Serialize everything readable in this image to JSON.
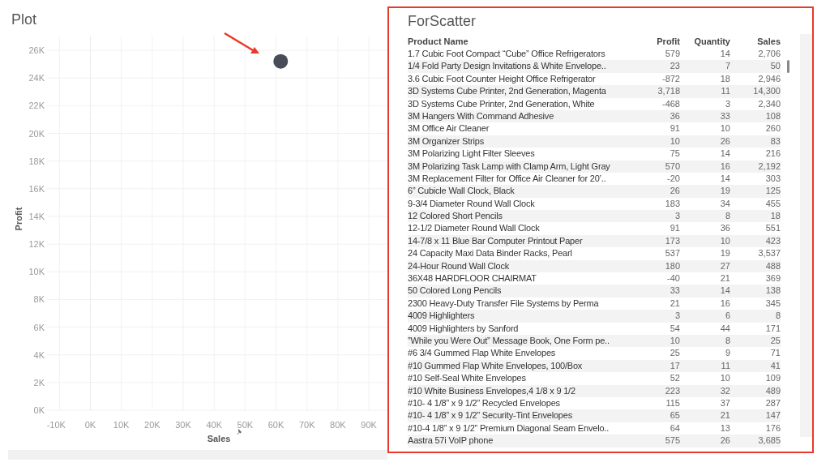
{
  "plot": {
    "title": "Plot",
    "chart_data": {
      "type": "scatter",
      "xlabel": "Sales",
      "ylabel": "Profit",
      "x": [
        61500
      ],
      "series": [
        {
          "color": "#474c57",
          "values": [
            25200
          ]
        }
      ],
      "grid": true,
      "ref_lines": [
        {
          "axis": "x",
          "value": 0
        }
      ],
      "xlim": [
        -14000,
        96000
      ],
      "ylim": [
        0,
        27000
      ],
      "xticks": [
        {
          "value": -10000,
          "label": "-10K"
        },
        {
          "value": 0,
          "label": "0K"
        },
        {
          "value": 10000,
          "label": "10K"
        },
        {
          "value": 20000,
          "label": "20K"
        },
        {
          "value": 30000,
          "label": "30K"
        },
        {
          "value": 40000,
          "label": "40K"
        },
        {
          "value": 50000,
          "label": "50K"
        },
        {
          "value": 60000,
          "label": "60K"
        },
        {
          "value": 70000,
          "label": "70K"
        },
        {
          "value": 80000,
          "label": "80K"
        },
        {
          "value": 90000,
          "label": "90K"
        }
      ],
      "yticks": [
        {
          "value": 0,
          "label": "0K"
        },
        {
          "value": 2000,
          "label": "2K"
        },
        {
          "value": 4000,
          "label": "4K"
        },
        {
          "value": 6000,
          "label": "6K"
        },
        {
          "value": 8000,
          "label": "8K"
        },
        {
          "value": 10000,
          "label": "10K"
        },
        {
          "value": 12000,
          "label": "12K"
        },
        {
          "value": 14000,
          "label": "14K"
        },
        {
          "value": 16000,
          "label": "16K"
        },
        {
          "value": 18000,
          "label": "18K"
        },
        {
          "value": 20000,
          "label": "20K"
        },
        {
          "value": 22000,
          "label": "22K"
        },
        {
          "value": 24000,
          "label": "24K"
        },
        {
          "value": 26000,
          "label": "26K"
        }
      ]
    }
  },
  "table": {
    "title": "ForScatter",
    "columns": [
      "Product Name",
      "Profit",
      "Quantity",
      "Sales"
    ],
    "rows": [
      [
        "1.7 Cubic Foot Compact “Cube” Office Refrigerators",
        "579",
        "14",
        "2,706"
      ],
      [
        "1/4 Fold Party Design Invitations & White Envelope..",
        "23",
        "7",
        "50"
      ],
      [
        "3.6 Cubic Foot Counter Height Office Refrigerator",
        "-872",
        "18",
        "2,946"
      ],
      [
        "3D Systems Cube Printer, 2nd Generation, Magenta",
        "3,718",
        "11",
        "14,300"
      ],
      [
        "3D Systems Cube Printer, 2nd Generation, White",
        "-468",
        "3",
        "2,340"
      ],
      [
        "3M Hangers With Command Adhesive",
        "36",
        "33",
        "108"
      ],
      [
        "3M Office Air Cleaner",
        "91",
        "10",
        "260"
      ],
      [
        "3M Organizer Strips",
        "10",
        "26",
        "83"
      ],
      [
        "3M Polarizing Light Filter Sleeves",
        "75",
        "14",
        "216"
      ],
      [
        "3M Polarizing Task Lamp with Clamp Arm, Light Gray",
        "570",
        "16",
        "2,192"
      ],
      [
        "3M Replacement Filter for Office Air Cleaner for 20’..",
        "-20",
        "14",
        "303"
      ],
      [
        "6” Cubicle Wall Clock, Black",
        "26",
        "19",
        "125"
      ],
      [
        "9-3/4 Diameter Round Wall Clock",
        "183",
        "34",
        "455"
      ],
      [
        "12 Colored Short Pencils",
        "3",
        "8",
        "18"
      ],
      [
        "12-1/2 Diameter Round Wall Clock",
        "91",
        "36",
        "551"
      ],
      [
        "14-7/8 x 11 Blue Bar Computer Printout Paper",
        "173",
        "10",
        "423"
      ],
      [
        "24 Capacity Maxi Data Binder Racks, Pearl",
        "537",
        "19",
        "3,537"
      ],
      [
        "24-Hour Round Wall Clock",
        "180",
        "27",
        "488"
      ],
      [
        "36X48 HARDFLOOR CHAIRMAT",
        "-40",
        "21",
        "369"
      ],
      [
        "50 Colored Long Pencils",
        "33",
        "14",
        "138"
      ],
      [
        "2300 Heavy-Duty Transfer File Systems by Perma",
        "21",
        "16",
        "345"
      ],
      [
        "4009 Highlighters",
        "3",
        "6",
        "8"
      ],
      [
        "4009 Highlighters by Sanford",
        "54",
        "44",
        "171"
      ],
      [
        "”While you Were Out” Message Book, One Form pe..",
        "10",
        "8",
        "25"
      ],
      [
        "#6 3/4 Gummed Flap White Envelopes",
        "25",
        "9",
        "71"
      ],
      [
        "#10 Gummed Flap White Envelopes, 100/Box",
        "17",
        "11",
        "41"
      ],
      [
        "#10 Self-Seal White Envelopes",
        "52",
        "10",
        "109"
      ],
      [
        "#10 White Business Envelopes,4 1/8 x 9 1/2",
        "223",
        "32",
        "489"
      ],
      [
        "#10- 4 1/8” x 9 1/2” Recycled Envelopes",
        "115",
        "37",
        "287"
      ],
      [
        "#10- 4 1/8” x 9 1/2” Security-Tint Envelopes",
        "65",
        "21",
        "147"
      ],
      [
        "#10-4 1/8” x 9 1/2” Premium Diagonal Seam Envelo..",
        "64",
        "13",
        "176"
      ],
      [
        "Aastra 57i VoIP phone",
        "575",
        "26",
        "3,685"
      ]
    ]
  }
}
